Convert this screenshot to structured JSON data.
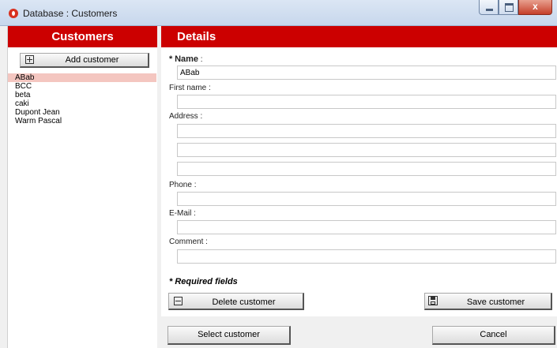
{
  "window": {
    "title": "Database : Customers",
    "close_glyph": "x"
  },
  "customers_panel": {
    "title": "Customers",
    "add_button_label": "Add customer",
    "items": [
      "ABab",
      "BCC",
      "beta",
      "caki",
      "Dupont Jean",
      "Warm Pascal"
    ],
    "selected_index": 0
  },
  "details_panel": {
    "title": "Details",
    "name_label": "Name",
    "name_value": "ABab",
    "first_name_label": "First name :",
    "first_name_value": "",
    "address_label": "Address :",
    "address_lines": [
      "",
      "",
      ""
    ],
    "phone_label": "Phone :",
    "phone_value": "",
    "email_label": "E-Mail :",
    "email_value": "",
    "comment_label": "Comment :",
    "comment_value": "",
    "required_note": "* Required fields",
    "delete_button_label": "Delete customer",
    "save_button_label": "Save customer"
  },
  "footer": {
    "select_button_label": "Select customer",
    "cancel_button_label": "Cancel"
  },
  "colors": {
    "header_red": "#cc0000",
    "selected_row": "#f4c6c0"
  },
  "icons": [
    "app-logo-icon",
    "minimize-icon",
    "maximize-icon",
    "close-icon",
    "plus-box-icon",
    "minus-box-icon",
    "floppy-disk-icon"
  ]
}
